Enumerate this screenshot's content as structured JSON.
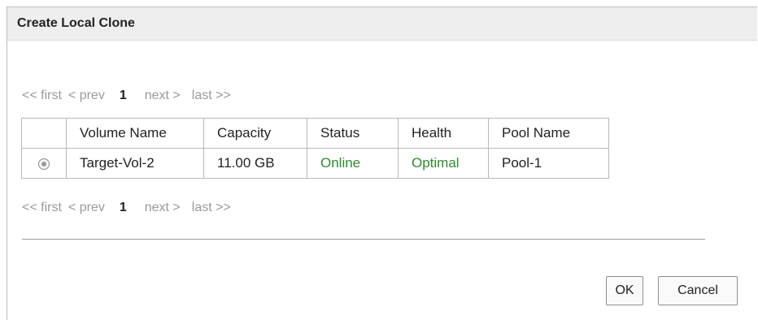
{
  "dialog": {
    "title": "Create Local Clone"
  },
  "pager": {
    "first": "<< first",
    "prev": "< prev",
    "current": "1",
    "next": "next >",
    "last": "last >>"
  },
  "table": {
    "headers": [
      "",
      "Volume Name",
      "Capacity",
      "Status",
      "Health",
      "Pool Name"
    ],
    "rows": [
      {
        "selected": true,
        "volume_name": "Target-Vol-2",
        "capacity": "11.00 GB",
        "status": "Online",
        "health": "Optimal",
        "pool_name": "Pool-1"
      }
    ]
  },
  "status_color": "#2e8b2e",
  "buttons": {
    "ok": "OK",
    "cancel": "Cancel"
  }
}
